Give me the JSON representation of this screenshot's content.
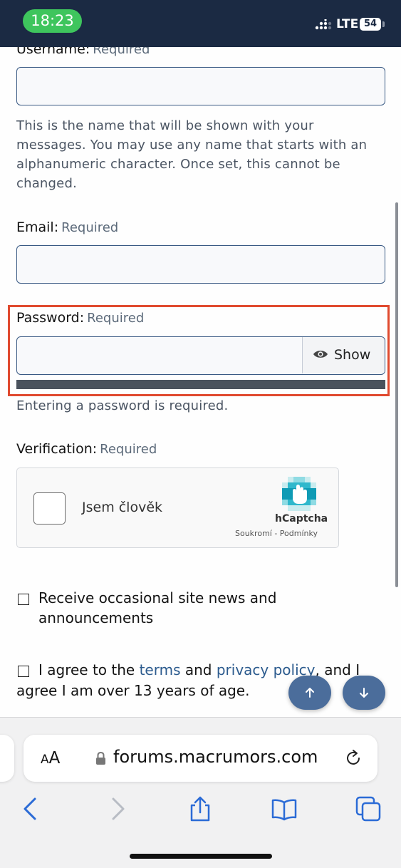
{
  "status_bar": {
    "time": "18:23",
    "network": "LTE",
    "battery": "54"
  },
  "form": {
    "username": {
      "label": "Username:",
      "required": "Required",
      "value": "",
      "hint": "This is the name that will be shown with your messages. You may use any name that starts with an alphanumeric character. Once set, this cannot be changed."
    },
    "email": {
      "label": "Email:",
      "required": "Required",
      "value": ""
    },
    "password": {
      "label": "Password:",
      "required": "Required",
      "value": "",
      "show_label": "Show",
      "error": "Entering a password is required."
    },
    "verification": {
      "label": "Verification:",
      "required": "Required",
      "captcha_label": "Jsem člověk",
      "captcha_brand": "hCaptcha",
      "captcha_links": "Soukromí - Podmínky"
    },
    "news_checkbox": {
      "line1": "Receive occasional site news and",
      "line2": "announcements"
    },
    "terms_checkbox": {
      "prefix": "I agree to the",
      "terms": "terms",
      "and": "and",
      "privacy": "privacy policy",
      "suffix": ", and I",
      "line2": "agree I am over 13 years of age."
    }
  },
  "browser": {
    "aa_small": "A",
    "aa_big": "A",
    "url": "forums.macrumors.com"
  },
  "colors": {
    "accent": "#4b6d9b",
    "highlight": "#e04a2f",
    "status_bar": "#1b2a43",
    "link": "#2c5b8e"
  }
}
